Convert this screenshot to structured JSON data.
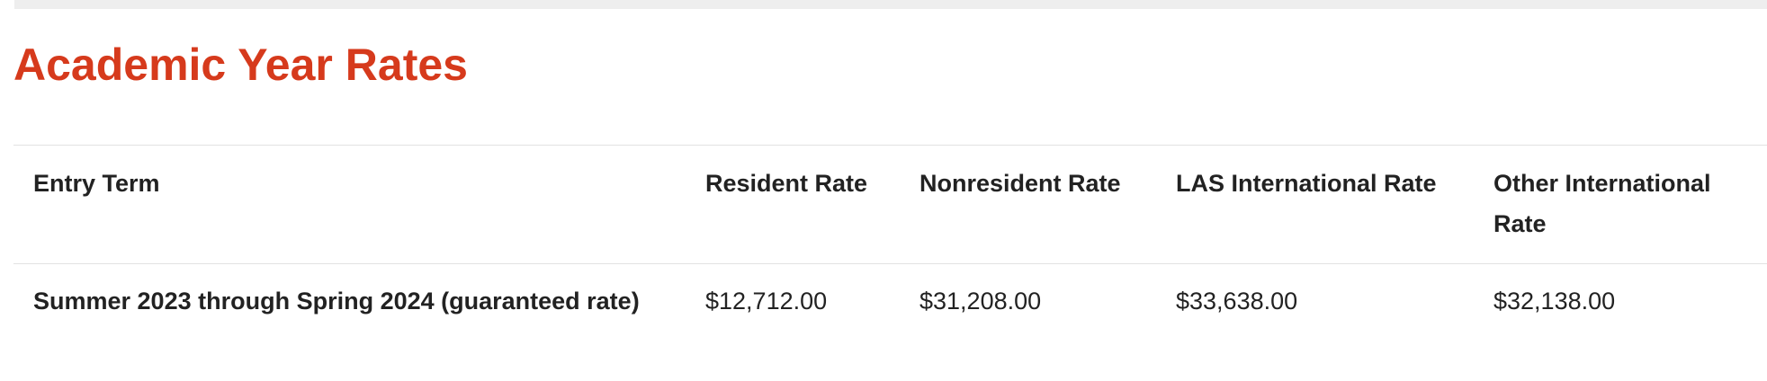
{
  "page": {
    "title": "Academic Year Rates",
    "colors": {
      "title": "#d63a1c",
      "text": "#222222",
      "rule": "#e2e2e2"
    }
  },
  "table": {
    "headers": [
      "Entry Term",
      "Resident Rate",
      "Nonresident Rate",
      "LAS International Rate",
      "Other International Rate"
    ],
    "rows": [
      {
        "entry_term": "Summer 2023 through Spring 2024 (guaranteed rate)",
        "resident": "$12,712.00",
        "nonresident": "$31,208.00",
        "las_international": "$33,638.00",
        "other_international": "$32,138.00"
      }
    ]
  }
}
